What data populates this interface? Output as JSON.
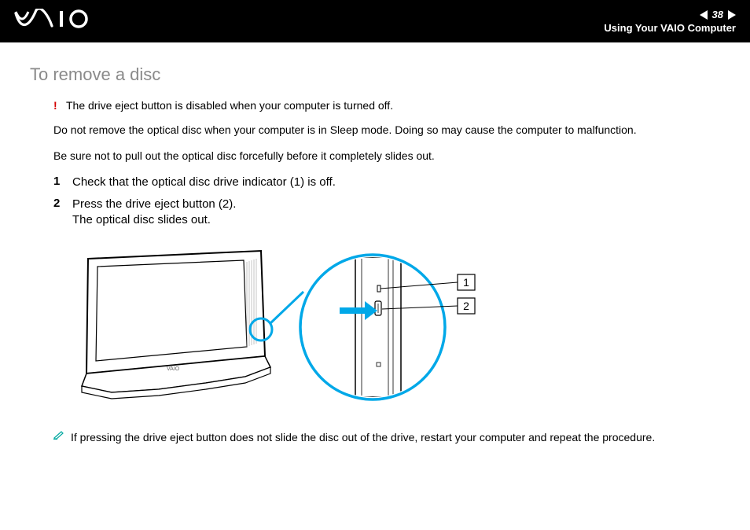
{
  "header": {
    "logo_text": "VAIO",
    "page_number": "38",
    "section_label": "Using Your VAIO Computer"
  },
  "title": "To remove a disc",
  "warnings": [
    "The drive eject button is disabled when your computer is turned off.",
    "Do not remove the optical disc when your computer is in Sleep mode. Doing so may cause the computer to malfunction.",
    "Be sure not to pull out the optical disc forcefully before it completely slides out."
  ],
  "steps": [
    {
      "num": "1",
      "text": "Check that the optical disc drive indicator (1) is off."
    },
    {
      "num": "2",
      "text": "Press the drive eject button (2).\nThe optical disc slides out."
    }
  ],
  "callouts": {
    "label1": "1",
    "label2": "2"
  },
  "note": "If pressing the drive eject button does not slide the disc out of the drive, restart your computer and repeat the procedure."
}
